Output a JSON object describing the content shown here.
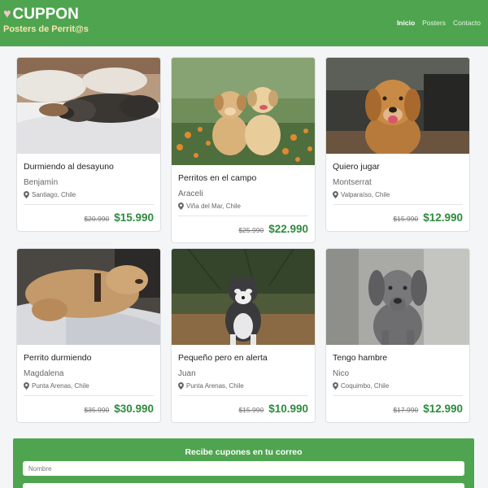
{
  "header": {
    "brand": "CUPPON",
    "tagline": "Posters de Perrit@s",
    "nav": [
      {
        "label": "Inicio",
        "active": true
      },
      {
        "label": "Posters",
        "active": false
      },
      {
        "label": "Contacto",
        "active": false
      }
    ]
  },
  "cards": [
    {
      "title": "Durmiendo al desayuno",
      "author": "Benjamín",
      "location": "Santiago, Chile",
      "old_price": "$20.990",
      "price": "$15.990",
      "image": "black-dog-sleeping-on-bed"
    },
    {
      "title": "Perritos en el campo",
      "author": "Araceli",
      "location": "Viña del Mar, Chile",
      "old_price": "$25.990",
      "price": "$22.990",
      "image": "two-golden-puppies-in-field"
    },
    {
      "title": "Quiero jugar",
      "author": "Montserrat",
      "location": "Valparaíso, Chile",
      "old_price": "$15.990",
      "price": "$12.990",
      "image": "golden-retriever-smiling"
    },
    {
      "title": "Perrito durmiendo",
      "author": "Magdalena",
      "location": "Punta Arenas, Chile",
      "old_price": "$35.990",
      "price": "$30.990",
      "image": "labrador-sleeping-on-blanket"
    },
    {
      "title": "Pequeño pero en alerta",
      "author": "Juan",
      "location": "Punta Arenas, Chile",
      "old_price": "$15.990",
      "price": "$10.990",
      "image": "husky-puppy-in-forest"
    },
    {
      "title": "Tengo hambre",
      "author": "Nico",
      "location": "Coquimbo, Chile",
      "old_price": "$17.990",
      "price": "$12.990",
      "image": "gray-weimaraner-puppy"
    }
  ],
  "subscribe": {
    "title": "Recibe cupones en tu correo",
    "name_placeholder": "Nombre",
    "email_placeholder": ""
  },
  "colors": {
    "brand_green": "#4fa54f",
    "price_green": "#2e8b3e"
  }
}
